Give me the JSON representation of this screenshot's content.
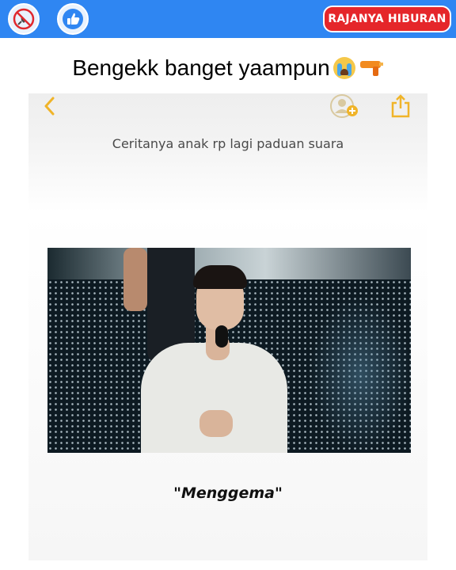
{
  "topbar": {
    "brand_label": "RAJANYA HIBURAN",
    "icons": [
      "no-pin-icon",
      "thumbs-up-icon"
    ]
  },
  "post": {
    "caption": "Bengekk banget yaampun",
    "caption_emojis": [
      "loudly-crying-face-icon",
      "water-pistol-icon"
    ]
  },
  "screen": {
    "icons": [
      "chevron-left-icon",
      "add-contact-icon",
      "share-icon"
    ],
    "subtitle": "Ceritanya anak rp lagi paduan suara",
    "quote": "\"Menggema\""
  },
  "colors": {
    "topbar": "#2f86f2",
    "brand_badge": "#e5262a",
    "accent_icon": "#f0b429"
  }
}
